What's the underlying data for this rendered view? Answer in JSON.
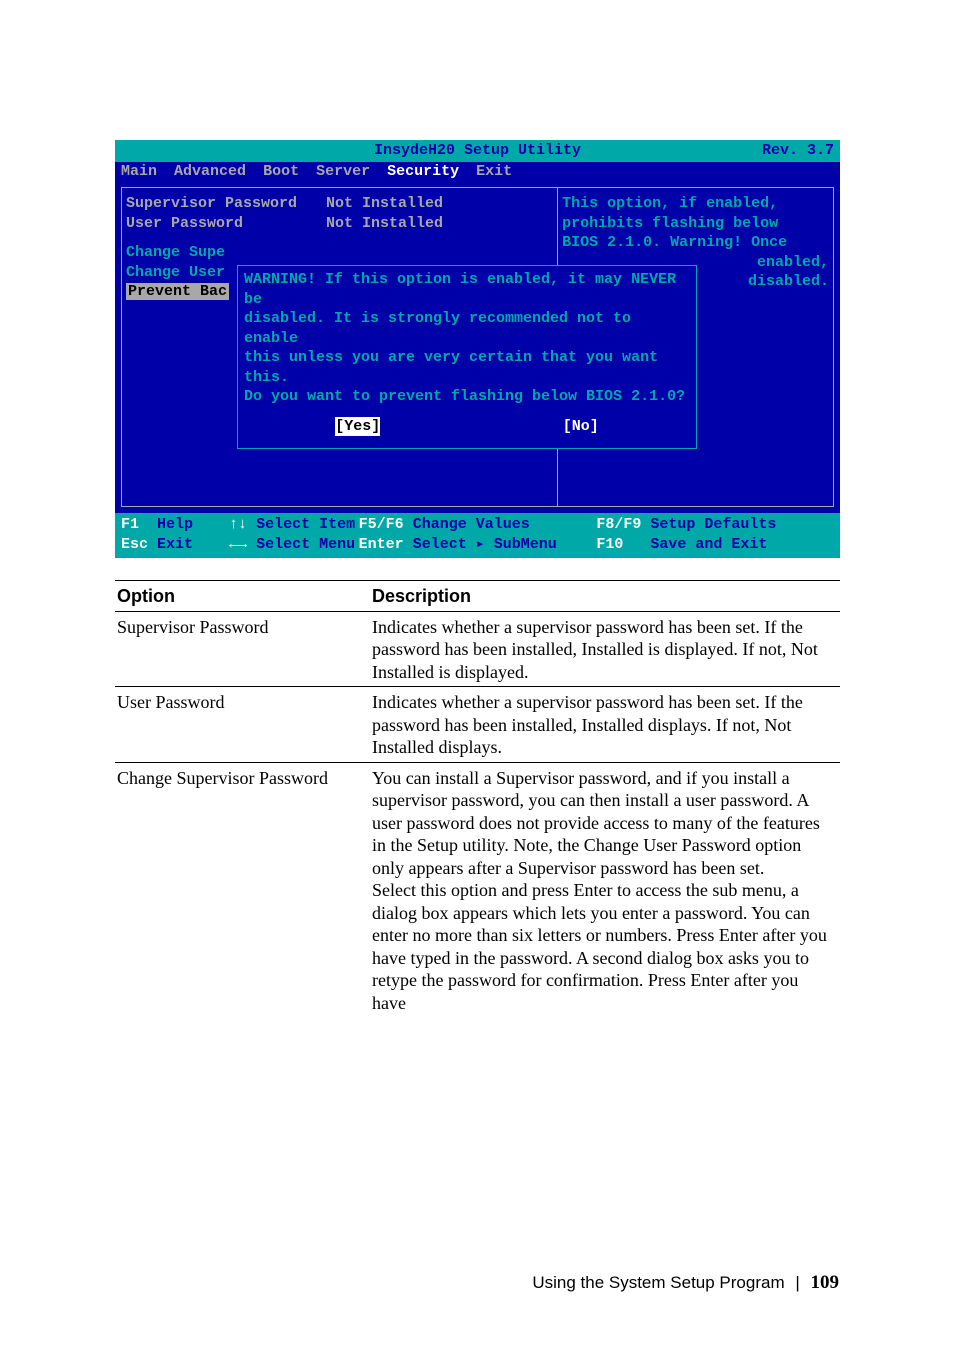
{
  "bios": {
    "title": "InsydeH20 Setup Utility",
    "rev": "Rev. 3.7",
    "tabs": [
      "Main",
      "Advanced",
      "Boot",
      "Server",
      "Security",
      "Exit"
    ],
    "active_tab_index": 4,
    "fields": [
      {
        "label": "Supervisor Password",
        "value": "Not Installed"
      },
      {
        "label": "User Password",
        "value": "Not Installed"
      }
    ],
    "menu_items": [
      "Change Supe",
      "Change User"
    ],
    "menu_selected": "Prevent Bac",
    "help": {
      "line1": "This option, if enabled,",
      "line2": "prohibits flashing below",
      "line3": "BIOS 2.1.0. Warning! Once",
      "line4": "enabled,",
      "line5": "disabled."
    },
    "dialog": {
      "text1": "WARNING! If this option is enabled, it may NEVER be",
      "text2": "disabled.  It is strongly recommended not to enable",
      "text3": "this unless you are very certain that you want this.",
      "text4": "Do you want to prevent flashing below BIOS 2.1.0?",
      "yes": "[Yes]",
      "no": "[No]"
    },
    "footer": {
      "f1": "F1",
      "help": "Help",
      "updown": "↑↓",
      "select_item": "Select Item",
      "f5f6": "F5/F6",
      "change_values": "Change Values",
      "f8f9": "F8/F9",
      "setup_defaults": "Setup Defaults",
      "esc": "Esc",
      "exit": "Exit",
      "lr": "←→",
      "select_menu": "Select Menu",
      "enter": "Enter",
      "select_sub": "Select ▸ SubMenu",
      "f10": "F10",
      "save_exit": "Save and Exit"
    }
  },
  "table": {
    "headers": [
      "Option",
      "Description"
    ],
    "rows": [
      {
        "option": "Supervisor Password",
        "desc": "Indicates whether a supervisor password has been set. If the password has been installed, Installed is displayed. If not, Not Installed is displayed."
      },
      {
        "option": "User Password",
        "desc": "Indicates whether a supervisor password has been set. If the password has been installed, Installed displays. If not, Not Installed displays."
      },
      {
        "option": "Change Supervisor Password",
        "desc": "You can install a Supervisor password, and if you install a supervisor password, you can then install a user password. A user password does not provide access to many of the features in the Setup utility. Note, the Change User Password option only appears after a Supervisor password has been set.\nSelect this option and press Enter to access the sub menu, a dialog box appears which lets you enter a password. You can enter no more than six letters or numbers. Press Enter after you have typed in the password. A second dialog box asks you to retype the password for confirmation. Press Enter after you have"
      }
    ]
  },
  "footer": {
    "section": "Using the System Setup Program",
    "page": "109"
  }
}
